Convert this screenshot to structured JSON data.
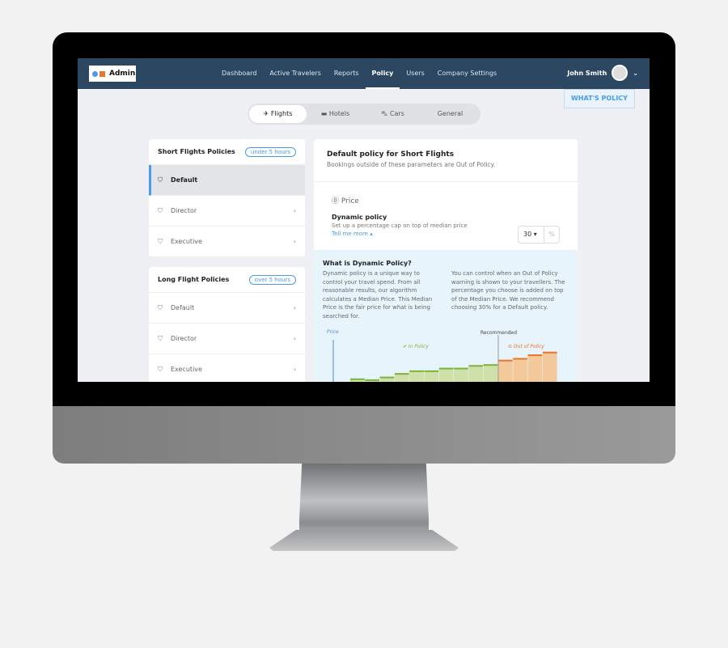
{
  "nav": {
    "logo": "Admin",
    "links": [
      "Dashboard",
      "Active Travelers",
      "Reports",
      "Policy",
      "Users",
      "Company Settings"
    ],
    "active": "Policy",
    "user": "John Smith"
  },
  "whats_policy": "WHAT'S POLICY",
  "tabs": [
    {
      "label": "Flights",
      "icon": "plane-icon"
    },
    {
      "label": "Hotels",
      "icon": "bed-icon"
    },
    {
      "label": "Cars",
      "icon": "car-icon"
    },
    {
      "label": "General",
      "icon": ""
    }
  ],
  "short": {
    "title": "Short Flights Policies",
    "badge": "under 5 hours",
    "items": [
      "Default",
      "Director",
      "Executive"
    ]
  },
  "long": {
    "title": "Long Flight Policies",
    "badge": "over 5 hours",
    "items": [
      "Default",
      "Director",
      "Executive"
    ]
  },
  "main": {
    "title": "Default policy for Short Flights",
    "subtitle": "Bookings outside of these parameters are Out of Policy.",
    "section": "Price",
    "dyn_title": "Dynamic policy",
    "dyn_desc": "Set up a percentage cap on top of median price",
    "tell_more": "Tell me more",
    "select_value": "30",
    "unit": "%"
  },
  "info": {
    "title": "What is Dynamic Policy?",
    "col1": "Dynamic policy is a unique way to control your travel spend. From all reasonable results, our algorithm calculates a Median Price. This Median Price is the fair price for what is being searched for.",
    "col2": "You can control when an Out of Policy warning is shown to your travellers. The percentage you choose is added on top of the Median Price. We recommend choosing 30% for a Default policy."
  },
  "chart_data": {
    "type": "bar",
    "ylabel": "Price",
    "annotations": [
      "Recommended",
      "In Policy",
      "Out of Policy"
    ],
    "values": [
      2,
      1,
      4,
      8,
      11,
      11,
      14,
      14,
      17,
      18,
      23,
      25,
      29,
      32
    ],
    "in_policy_count": 10,
    "colors": {
      "in": "#cfe0a8",
      "in_top": "#7fb33a",
      "out": "#f3c89a",
      "out_top": "#e9762b"
    }
  }
}
